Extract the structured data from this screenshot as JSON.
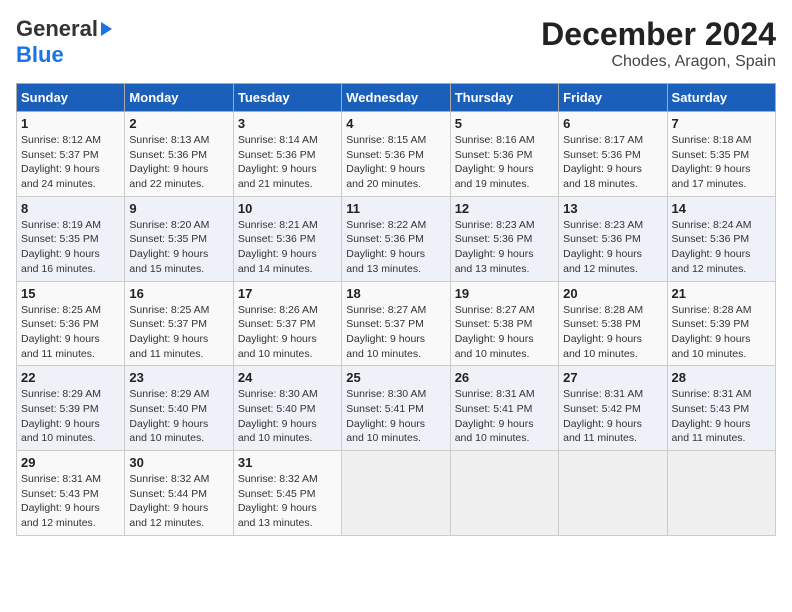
{
  "header": {
    "logo_general": "General",
    "logo_blue": "Blue",
    "title": "December 2024",
    "subtitle": "Chodes, Aragon, Spain"
  },
  "calendar": {
    "weekdays": [
      "Sunday",
      "Monday",
      "Tuesday",
      "Wednesday",
      "Thursday",
      "Friday",
      "Saturday"
    ],
    "weeks": [
      [
        {
          "day": "",
          "info": ""
        },
        {
          "day": "",
          "info": ""
        },
        {
          "day": "",
          "info": ""
        },
        {
          "day": "",
          "info": ""
        },
        {
          "day": "5",
          "info": "Sunrise: 8:16 AM\nSunset: 5:36 PM\nDaylight: 9 hours\nand 19 minutes."
        },
        {
          "day": "6",
          "info": "Sunrise: 8:17 AM\nSunset: 5:36 PM\nDaylight: 9 hours\nand 18 minutes."
        },
        {
          "day": "7",
          "info": "Sunrise: 8:18 AM\nSunset: 5:35 PM\nDaylight: 9 hours\nand 17 minutes."
        }
      ],
      [
        {
          "day": "1",
          "info": "Sunrise: 8:12 AM\nSunset: 5:37 PM\nDaylight: 9 hours\nand 24 minutes."
        },
        {
          "day": "2",
          "info": "Sunrise: 8:13 AM\nSunset: 5:36 PM\nDaylight: 9 hours\nand 22 minutes."
        },
        {
          "day": "3",
          "info": "Sunrise: 8:14 AM\nSunset: 5:36 PM\nDaylight: 9 hours\nand 21 minutes."
        },
        {
          "day": "4",
          "info": "Sunrise: 8:15 AM\nSunset: 5:36 PM\nDaylight: 9 hours\nand 20 minutes."
        },
        {
          "day": "5",
          "info": "Sunrise: 8:16 AM\nSunset: 5:36 PM\nDaylight: 9 hours\nand 19 minutes."
        },
        {
          "day": "6",
          "info": "Sunrise: 8:17 AM\nSunset: 5:36 PM\nDaylight: 9 hours\nand 18 minutes."
        },
        {
          "day": "7",
          "info": "Sunrise: 8:18 AM\nSunset: 5:35 PM\nDaylight: 9 hours\nand 17 minutes."
        }
      ],
      [
        {
          "day": "8",
          "info": "Sunrise: 8:19 AM\nSunset: 5:35 PM\nDaylight: 9 hours\nand 16 minutes."
        },
        {
          "day": "9",
          "info": "Sunrise: 8:20 AM\nSunset: 5:35 PM\nDaylight: 9 hours\nand 15 minutes."
        },
        {
          "day": "10",
          "info": "Sunrise: 8:21 AM\nSunset: 5:36 PM\nDaylight: 9 hours\nand 14 minutes."
        },
        {
          "day": "11",
          "info": "Sunrise: 8:22 AM\nSunset: 5:36 PM\nDaylight: 9 hours\nand 13 minutes."
        },
        {
          "day": "12",
          "info": "Sunrise: 8:23 AM\nSunset: 5:36 PM\nDaylight: 9 hours\nand 13 minutes."
        },
        {
          "day": "13",
          "info": "Sunrise: 8:23 AM\nSunset: 5:36 PM\nDaylight: 9 hours\nand 12 minutes."
        },
        {
          "day": "14",
          "info": "Sunrise: 8:24 AM\nSunset: 5:36 PM\nDaylight: 9 hours\nand 12 minutes."
        }
      ],
      [
        {
          "day": "15",
          "info": "Sunrise: 8:25 AM\nSunset: 5:36 PM\nDaylight: 9 hours\nand 11 minutes."
        },
        {
          "day": "16",
          "info": "Sunrise: 8:25 AM\nSunset: 5:37 PM\nDaylight: 9 hours\nand 11 minutes."
        },
        {
          "day": "17",
          "info": "Sunrise: 8:26 AM\nSunset: 5:37 PM\nDaylight: 9 hours\nand 10 minutes."
        },
        {
          "day": "18",
          "info": "Sunrise: 8:27 AM\nSunset: 5:37 PM\nDaylight: 9 hours\nand 10 minutes."
        },
        {
          "day": "19",
          "info": "Sunrise: 8:27 AM\nSunset: 5:38 PM\nDaylight: 9 hours\nand 10 minutes."
        },
        {
          "day": "20",
          "info": "Sunrise: 8:28 AM\nSunset: 5:38 PM\nDaylight: 9 hours\nand 10 minutes."
        },
        {
          "day": "21",
          "info": "Sunrise: 8:28 AM\nSunset: 5:39 PM\nDaylight: 9 hours\nand 10 minutes."
        }
      ],
      [
        {
          "day": "22",
          "info": "Sunrise: 8:29 AM\nSunset: 5:39 PM\nDaylight: 9 hours\nand 10 minutes."
        },
        {
          "day": "23",
          "info": "Sunrise: 8:29 AM\nSunset: 5:40 PM\nDaylight: 9 hours\nand 10 minutes."
        },
        {
          "day": "24",
          "info": "Sunrise: 8:30 AM\nSunset: 5:40 PM\nDaylight: 9 hours\nand 10 minutes."
        },
        {
          "day": "25",
          "info": "Sunrise: 8:30 AM\nSunset: 5:41 PM\nDaylight: 9 hours\nand 10 minutes."
        },
        {
          "day": "26",
          "info": "Sunrise: 8:31 AM\nSunset: 5:41 PM\nDaylight: 9 hours\nand 10 minutes."
        },
        {
          "day": "27",
          "info": "Sunrise: 8:31 AM\nSunset: 5:42 PM\nDaylight: 9 hours\nand 11 minutes."
        },
        {
          "day": "28",
          "info": "Sunrise: 8:31 AM\nSunset: 5:43 PM\nDaylight: 9 hours\nand 11 minutes."
        }
      ],
      [
        {
          "day": "29",
          "info": "Sunrise: 8:31 AM\nSunset: 5:43 PM\nDaylight: 9 hours\nand 12 minutes."
        },
        {
          "day": "30",
          "info": "Sunrise: 8:32 AM\nSunset: 5:44 PM\nDaylight: 9 hours\nand 12 minutes."
        },
        {
          "day": "31",
          "info": "Sunrise: 8:32 AM\nSunset: 5:45 PM\nDaylight: 9 hours\nand 13 minutes."
        },
        {
          "day": "",
          "info": ""
        },
        {
          "day": "",
          "info": ""
        },
        {
          "day": "",
          "info": ""
        },
        {
          "day": "",
          "info": ""
        }
      ]
    ]
  }
}
